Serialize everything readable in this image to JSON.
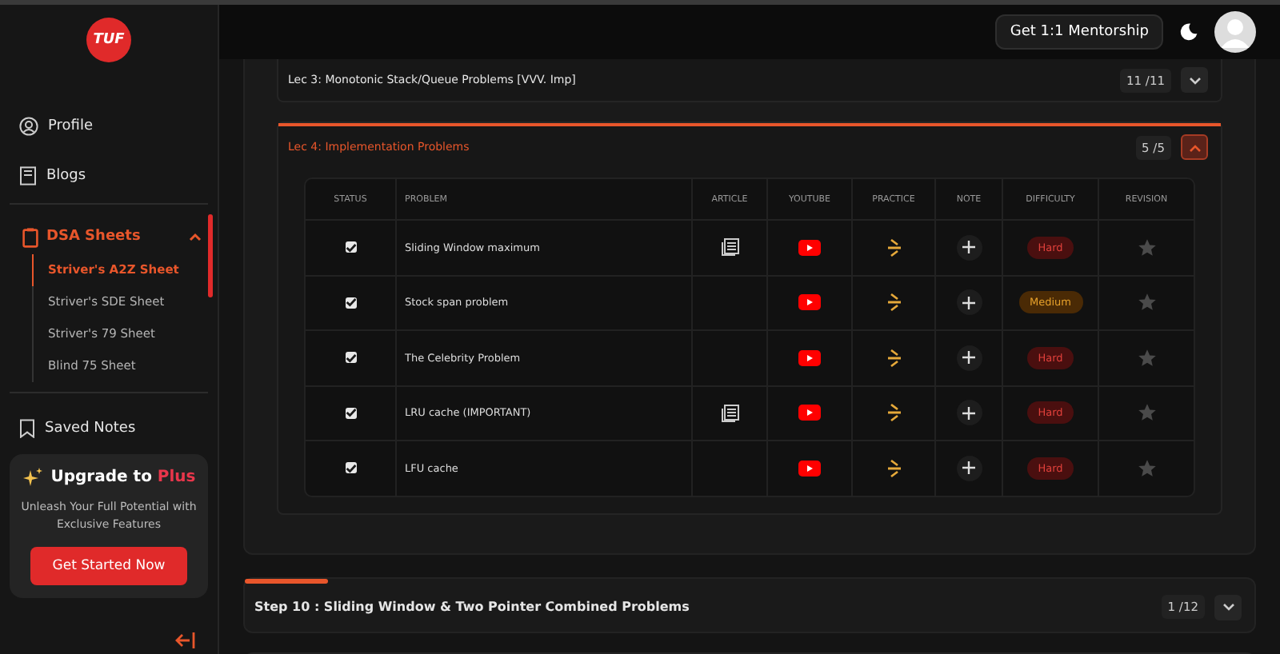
{
  "logo": {
    "text": "TUF"
  },
  "sidebar": {
    "items": [
      {
        "label": "Profile",
        "kind": "profile"
      },
      {
        "label": "Blogs",
        "kind": "blogs"
      }
    ],
    "sheets": {
      "label": "DSA Sheets",
      "expanded": true,
      "children": [
        {
          "label": "Striver's A2Z Sheet",
          "selected": true
        },
        {
          "label": "Striver's SDE Sheet",
          "selected": false
        },
        {
          "label": "Striver's 79 Sheet",
          "selected": false
        },
        {
          "label": "Blind 75 Sheet",
          "selected": false
        }
      ]
    },
    "saved_notes": "Saved Notes",
    "upgrade": {
      "title": "Upgrade to **Plus**",
      "text": "Unleash Your Full Potential with Exclusive Features",
      "button": "Get Started Now"
    }
  },
  "topbar": {
    "mentorship": "Get 1:1 Mentorship"
  },
  "lectures": [
    {
      "title": "Lec 3: Monotonic Stack/Queue Problems [VVV. Imp]",
      "count": "11 /11",
      "expanded": false
    },
    {
      "title": "Lec 4: Implementation Problems",
      "count": "5 /5",
      "expanded": true,
      "level": 1
    }
  ],
  "table": {
    "columns": [
      "STATUS",
      "PROBLEM",
      "ARTICLE",
      "YOUTUBE",
      "PRACTICE",
      "NOTE",
      "DIFFICULTY",
      "REVISION"
    ],
    "rows": [
      {
        "checked": true,
        "problem": "Sliding Window maximum",
        "article": true,
        "difficulty": "Hard",
        "kind": "hard",
        "starred": false
      },
      {
        "checked": true,
        "problem": "Stock span problem",
        "article": false,
        "difficulty": "Medium",
        "kind": "medium",
        "starred": false
      },
      {
        "checked": true,
        "problem": "The Celebrity Problem",
        "article": false,
        "difficulty": "Hard",
        "kind": "hard",
        "starred": false
      },
      {
        "checked": true,
        "problem": "LRU cache (IMPORTANT)",
        "article": true,
        "difficulty": "Hard",
        "kind": "hard",
        "starred": false
      },
      {
        "checked": true,
        "problem": "LFU cache",
        "article": false,
        "difficulty": "Hard",
        "kind": "hard",
        "starred": false
      }
    ]
  },
  "steps": [
    {
      "title": "Step 10 : Sliding Window & Two Pointer Combined Problems",
      "count": "1 /12",
      "level": 0.083
    }
  ]
}
